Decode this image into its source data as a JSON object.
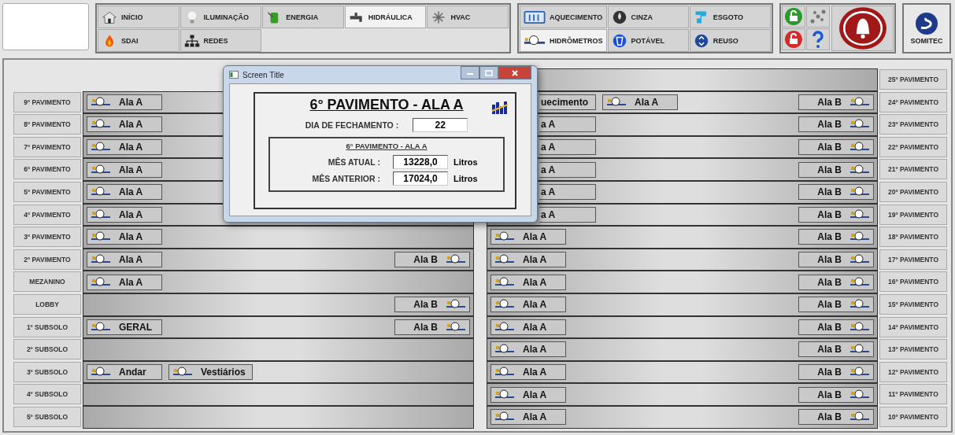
{
  "nav_primary": [
    {
      "label": "INÍCIO",
      "selected": false
    },
    {
      "label": "ILUMINAÇÃO",
      "selected": false
    },
    {
      "label": "ENERGIA",
      "selected": false
    },
    {
      "label": "HIDRÁULICA",
      "selected": true
    },
    {
      "label": "HVAC",
      "selected": false
    },
    {
      "label": "SDAI",
      "selected": false
    },
    {
      "label": "REDES",
      "selected": false
    }
  ],
  "nav_hydraulic": [
    {
      "label": "AQUECIMENTO",
      "selected": false
    },
    {
      "label": "CINZA",
      "selected": false
    },
    {
      "label": "ESGOTO",
      "selected": false
    },
    {
      "label": "HIDRÔMETROS",
      "selected": true
    },
    {
      "label": "POTÁVEL",
      "selected": false
    },
    {
      "label": "REUSO",
      "selected": false
    }
  ],
  "logo": {
    "text": "SOMITEC"
  },
  "left_floors": [
    {
      "label": "9º PAVIMENTO",
      "buttons": [
        {
          "text": "Ala A",
          "kind": "meter"
        }
      ]
    },
    {
      "label": "8º PAVIMENTO",
      "buttons": [
        {
          "text": "Ala A",
          "kind": "meter"
        }
      ]
    },
    {
      "label": "7º PAVIMENTO",
      "buttons": [
        {
          "text": "Ala A",
          "kind": "meter"
        }
      ]
    },
    {
      "label": "6º PAVIMENTO",
      "buttons": [
        {
          "text": "Ala A",
          "kind": "meter"
        }
      ]
    },
    {
      "label": "5º PAVIMENTO",
      "buttons": [
        {
          "text": "Ala A",
          "kind": "meter"
        }
      ]
    },
    {
      "label": "4º PAVIMENTO",
      "buttons": [
        {
          "text": "Ala A",
          "kind": "meter"
        }
      ]
    },
    {
      "label": "3º PAVIMENTO",
      "buttons": [
        {
          "text": "Ala A",
          "kind": "meter"
        }
      ]
    },
    {
      "label": "2º PAVIMENTO",
      "buttons": [
        {
          "text": "Ala A",
          "kind": "meter"
        },
        {
          "text": "Ala B",
          "kind": "meter-end"
        }
      ]
    },
    {
      "label": "MEZANINO",
      "buttons": [
        {
          "text": "Ala A",
          "kind": "meter"
        }
      ]
    },
    {
      "label": "LOBBY",
      "buttons": [
        {
          "text": "Ala B",
          "kind": "meter-end"
        }
      ]
    },
    {
      "label": "1º SUBSOLO",
      "buttons": [
        {
          "text": "GERAL",
          "kind": "meter"
        },
        {
          "text": "Ala B",
          "kind": "meter-end"
        }
      ]
    },
    {
      "label": "2º SUBSOLO"
    },
    {
      "label": "3º SUBSOLO",
      "buttons": [
        {
          "text": "Andar",
          "kind": "meter"
        },
        {
          "text": "Vestiários",
          "kind": "meter"
        }
      ]
    },
    {
      "label": "4º SUBSOLO"
    },
    {
      "label": "5º SUBSOLO"
    }
  ],
  "right_floors": [
    {
      "label": "25º PAVIMENTO"
    },
    {
      "label": "24º PAVIMENTO",
      "buttons": [
        {
          "text": "uecimento",
          "kind": "clipped"
        },
        {
          "text": "Ala A",
          "kind": "meter"
        },
        {
          "text": "Ala B",
          "kind": "meter-end"
        }
      ]
    },
    {
      "label": "23º PAVIMENTO",
      "buttons": [
        {
          "text": "a A",
          "kind": "clipped"
        },
        {
          "text": "Ala B",
          "kind": "meter-end"
        }
      ]
    },
    {
      "label": "22º PAVIMENTO",
      "buttons": [
        {
          "text": "a A",
          "kind": "clipped"
        },
        {
          "text": "Ala B",
          "kind": "meter-end"
        }
      ]
    },
    {
      "label": "21º PAVIMENTO",
      "buttons": [
        {
          "text": "a A",
          "kind": "clipped"
        },
        {
          "text": "Ala B",
          "kind": "meter-end"
        }
      ]
    },
    {
      "label": "20º PAVIMENTO",
      "buttons": [
        {
          "text": "a A",
          "kind": "clipped"
        },
        {
          "text": "Ala B",
          "kind": "meter-end"
        }
      ]
    },
    {
      "label": "19º PAVIMENTO",
      "buttons": [
        {
          "text": "a A",
          "kind": "clipped"
        },
        {
          "text": "Ala B",
          "kind": "meter-end"
        }
      ]
    },
    {
      "label": "18º PAVIMENTO",
      "buttons": [
        {
          "text": "Ala A",
          "kind": "meter"
        },
        {
          "text": "Ala B",
          "kind": "meter-end"
        }
      ]
    },
    {
      "label": "17º PAVIMENTO",
      "buttons": [
        {
          "text": "Ala A",
          "kind": "meter"
        },
        {
          "text": "Ala B",
          "kind": "meter-end"
        }
      ]
    },
    {
      "label": "16º PAVIMENTO",
      "buttons": [
        {
          "text": "Ala A",
          "kind": "meter"
        },
        {
          "text": "Ala B",
          "kind": "meter-end"
        }
      ]
    },
    {
      "label": "15º PAVIMENTO",
      "buttons": [
        {
          "text": "Ala A",
          "kind": "meter"
        },
        {
          "text": "Ala B",
          "kind": "meter-end"
        }
      ]
    },
    {
      "label": "14º PAVIMENTO",
      "buttons": [
        {
          "text": "Ala A",
          "kind": "meter"
        },
        {
          "text": "Ala B",
          "kind": "meter-end"
        }
      ]
    },
    {
      "label": "13º PAVIMENTO",
      "buttons": [
        {
          "text": "Ala A",
          "kind": "meter"
        },
        {
          "text": "Ala B",
          "kind": "meter-end"
        }
      ]
    },
    {
      "label": "12º PAVIMENTO",
      "buttons": [
        {
          "text": "Ala A",
          "kind": "meter"
        },
        {
          "text": "Ala B",
          "kind": "meter-end"
        }
      ]
    },
    {
      "label": "11º PAVIMENTO",
      "buttons": [
        {
          "text": "Ala A",
          "kind": "meter"
        },
        {
          "text": "Ala B",
          "kind": "meter-end"
        }
      ]
    },
    {
      "label": "10º PAVIMENTO",
      "buttons": [
        {
          "text": "Ala A",
          "kind": "meter"
        },
        {
          "text": "Ala B",
          "kind": "meter-end"
        }
      ]
    }
  ],
  "dialog": {
    "title": "Screen Title",
    "heading": "6° PAVIMENTO - ALA A",
    "closing_day_label": "DIA DE FECHAMENTO :",
    "closing_day": "22",
    "group_title": "6° PAVIMENTO - ALA A",
    "readings": [
      {
        "label": "MÊS ATUAL :",
        "value": "13228,0",
        "unit": "Litros"
      },
      {
        "label": "MÊS ANTERIOR :",
        "value": "17024,0",
        "unit": "Litros"
      }
    ]
  }
}
